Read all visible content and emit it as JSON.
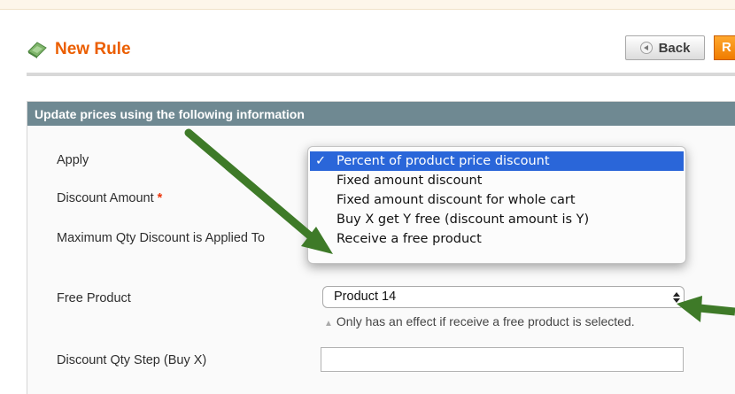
{
  "header": {
    "title": "New Rule",
    "back_label": "Back",
    "reset_label": "R"
  },
  "section": {
    "title": "Update prices using the following information",
    "apply_label": "Apply",
    "apply_selected": "Percent of product price discount",
    "apply_options": [
      "Percent of product price discount",
      "Fixed amount discount",
      "Fixed amount discount for whole cart",
      "Buy X get Y free (discount amount is Y)",
      "Receive a free product"
    ],
    "discount_amount_label": "Discount Amount",
    "required_mark": "*",
    "max_qty_label": "Maximum Qty Discount is Applied To",
    "free_product_label": "Free Product",
    "free_product_value": "Product 14",
    "free_product_hint": "Only has an effect if receive a free product is selected.",
    "discount_step_label": "Discount Qty Step (Buy X)"
  },
  "colors": {
    "accent": "#eb5e00",
    "section_header": "#6f8992",
    "arrow": "#3e7a28",
    "selection": "#2a66d9"
  },
  "icons": {
    "header": "new-rule-icon",
    "check": "checkmark-icon",
    "select": "up-down-arrow-icon",
    "hint": "triangle-up-icon"
  }
}
